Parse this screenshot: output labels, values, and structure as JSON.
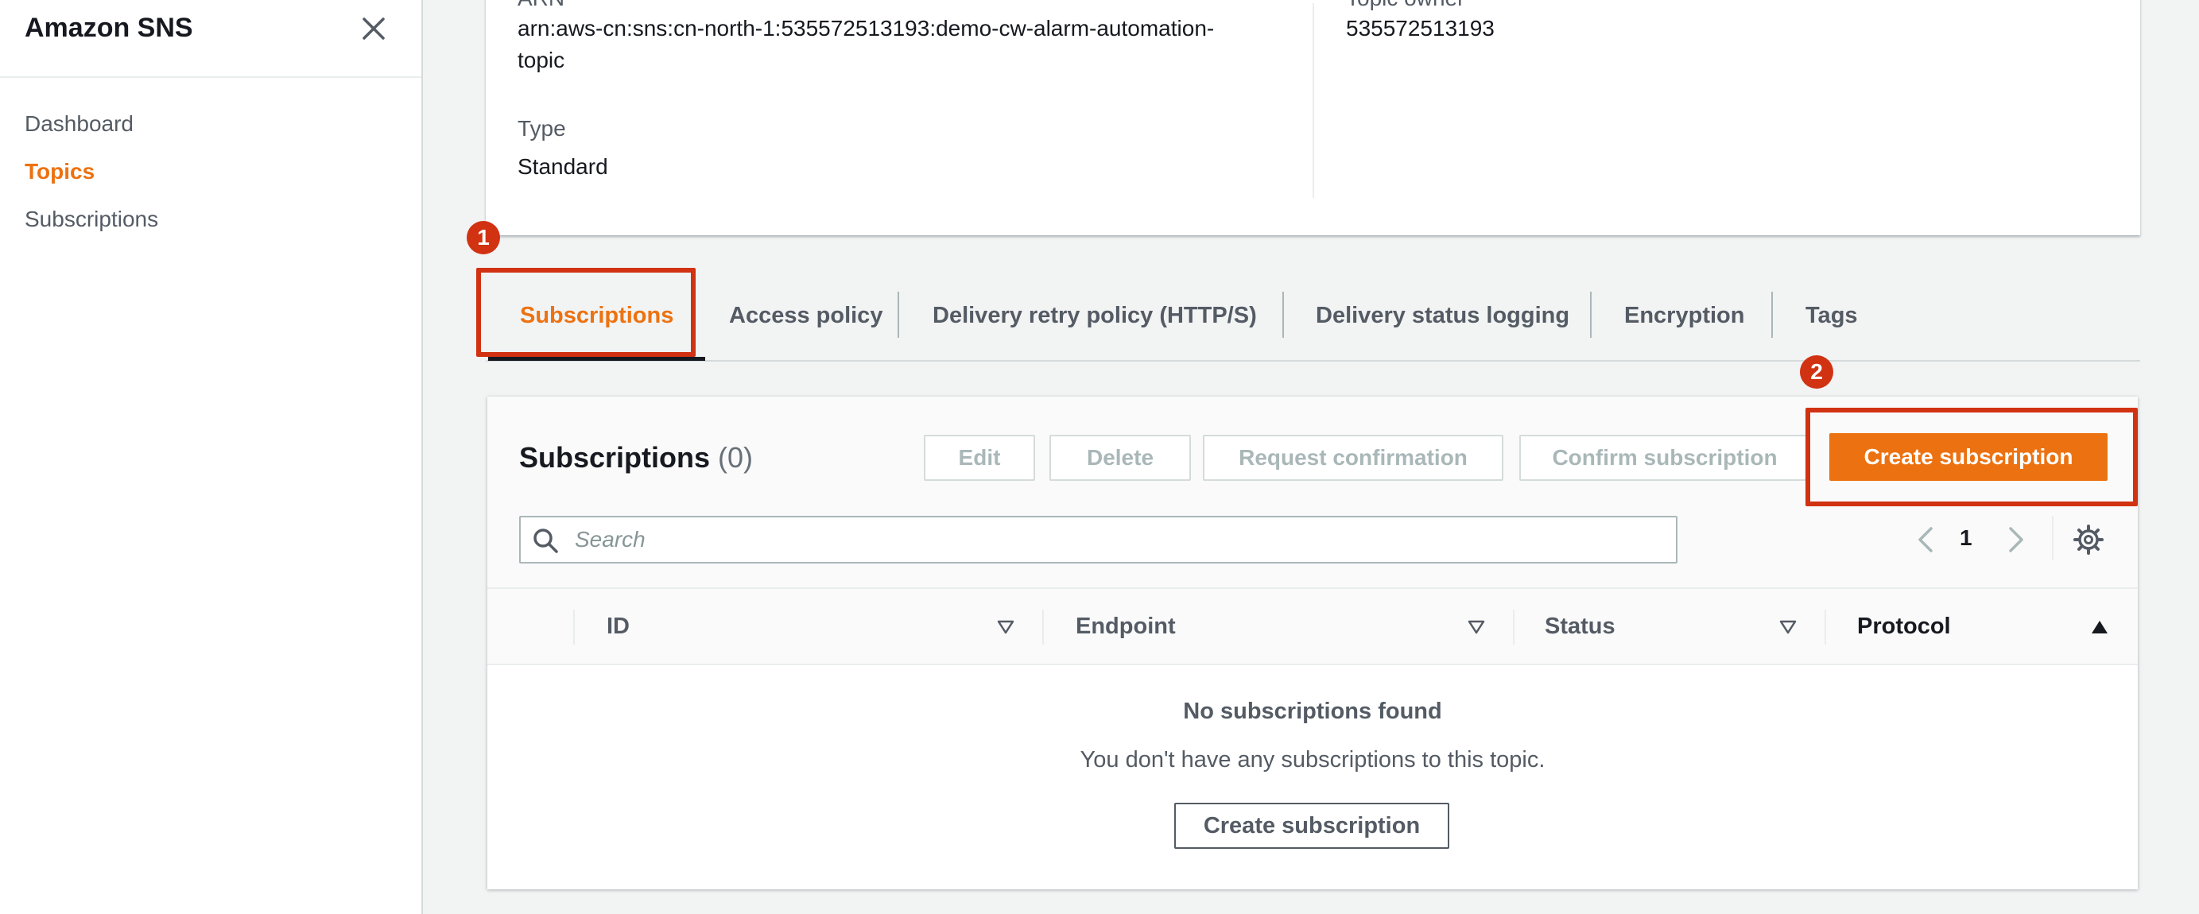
{
  "sidebar": {
    "title": "Amazon SNS",
    "items": [
      {
        "label": "Dashboard",
        "active": false
      },
      {
        "label": "Topics",
        "active": true
      },
      {
        "label": "Subscriptions",
        "active": false
      }
    ]
  },
  "details": {
    "arn_label": "ARN",
    "arn_value_line1": "arn:aws-cn:sns:cn-north-1:535572513193:demo-cw-alarm-automation-",
    "arn_value_line2": "topic",
    "type_label": "Type",
    "type_value": "Standard",
    "owner_label": "Topic owner",
    "owner_value": "535572513193"
  },
  "tabs": [
    {
      "label": "Subscriptions",
      "active": true
    },
    {
      "label": "Access policy",
      "active": false
    },
    {
      "label": "Delivery retry policy (HTTP/S)",
      "active": false
    },
    {
      "label": "Delivery status logging",
      "active": false
    },
    {
      "label": "Encryption",
      "active": false
    },
    {
      "label": "Tags",
      "active": false
    }
  ],
  "annotations": {
    "step1": "1",
    "step2": "2",
    "color": "#d13212"
  },
  "subscriptions": {
    "title": "Subscriptions",
    "count": "(0)",
    "buttons": {
      "edit": "Edit",
      "delete": "Delete",
      "request_confirmation": "Request confirmation",
      "confirm_subscription": "Confirm subscription",
      "create": "Create subscription"
    },
    "search_placeholder": "Search",
    "page": "1",
    "columns": [
      "ID",
      "Endpoint",
      "Status",
      "Protocol"
    ],
    "empty_title": "No subscriptions found",
    "empty_text": "You don't have any subscriptions to this topic.",
    "empty_button": "Create subscription"
  },
  "colors": {
    "accent": "#ec7211",
    "text": "#16191f",
    "muted": "#545b64"
  },
  "icons": [
    "close-icon",
    "search-icon",
    "chevron-left-icon",
    "chevron-right-icon",
    "settings-gear-icon",
    "sort-down-icon",
    "sort-up-icon"
  ]
}
